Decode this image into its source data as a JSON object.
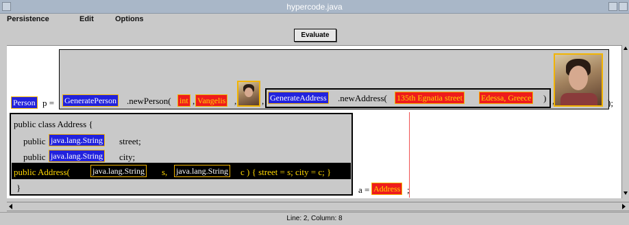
{
  "window": {
    "title": "hypercode.java"
  },
  "menu": [
    "Persistence",
    "Edit",
    "Options"
  ],
  "toolbar": {
    "evaluate_label": "Evaluate"
  },
  "code": {
    "line1": {
      "type_token": "Person",
      "var_text": "p =",
      "factory_token": "GeneratePerson",
      "method_text": ".newPerson(",
      "int_token": "int",
      "comma1": ",",
      "name_token": "Vangelis",
      "comma2": ",",
      "comma3": ",",
      "addr_factory_token": "GenerateAddress",
      "addr_method_text": ".newAddress(",
      "street_token": "135th Egnatia street",
      "city_token": "Edessa, Greece",
      "close_inner": ")",
      "comma4": ",",
      "close_outer": ");"
    },
    "class_box": {
      "decl": "public class Address {",
      "field1_public": "public",
      "field1_type": "java.lang.String",
      "field1_name": "street;",
      "field2_public": "public",
      "field2_type": "java.lang.String",
      "field2_name": "city;",
      "ctor_start": "public Address(",
      "ctor_type1": "java.lang.String",
      "ctor_param1": "s,",
      "ctor_type2": "java.lang.String",
      "ctor_param2": "c ) { street = s; city = c; }",
      "close": "}"
    },
    "assign": {
      "var_text": "a =",
      "token": "Address",
      "semi": ";"
    }
  },
  "status": {
    "text": "Line: 2, Column: 8"
  },
  "colors": {
    "title_bar": "#a9b7c8",
    "token_blue": "#2222dd",
    "token_red": "#ee1c1c",
    "token_border": "#f2b400"
  }
}
